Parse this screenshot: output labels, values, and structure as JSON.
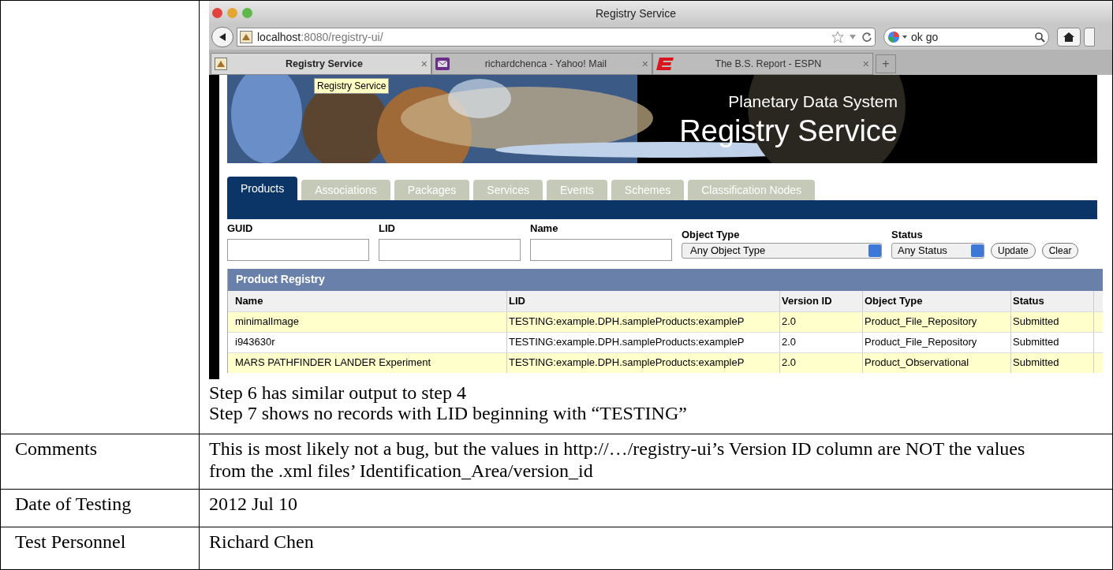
{
  "browser": {
    "title": "Registry Service",
    "url_host": "localhost",
    "url_rest": ":8080/registry-ui/",
    "search_value": "ok go",
    "tabs": [
      {
        "label": "Registry Service",
        "selected": true,
        "kind": "app"
      },
      {
        "label": "richardchenca - Yahoo! Mail",
        "selected": false,
        "kind": "mail"
      },
      {
        "label": "The B.S. Report - ESPN",
        "selected": false,
        "kind": "espn"
      }
    ],
    "new_tab": "+",
    "tab_close": "×"
  },
  "page": {
    "tooltip": "Registry Service",
    "banner_subtitle": "Planetary Data System",
    "banner_title": "Registry Service",
    "tabs": [
      {
        "label": "Products",
        "selected": true
      },
      {
        "label": "Associations",
        "selected": false
      },
      {
        "label": "Packages",
        "selected": false
      },
      {
        "label": "Services",
        "selected": false
      },
      {
        "label": "Events",
        "selected": false
      },
      {
        "label": "Schemes",
        "selected": false
      },
      {
        "label": "Classification Nodes",
        "selected": false
      }
    ],
    "filters": {
      "guid_label": "GUID",
      "lid_label": "LID",
      "name_label": "Name",
      "object_type_label": "Object Type",
      "object_type_value": "Any Object Type",
      "status_label": "Status",
      "status_value": "Any Status"
    },
    "buttons": [
      "Update",
      "Clear"
    ],
    "table": {
      "title": "Product Registry",
      "columns": [
        "Name",
        "LID",
        "Version ID",
        "Object Type",
        "Status"
      ],
      "rows": [
        {
          "highlighted": true,
          "cells": [
            "minimalImage",
            "TESTING:example.DPH.sampleProducts:exampleP",
            "2.0",
            "Product_File_Repository",
            "Submitted"
          ]
        },
        {
          "highlighted": false,
          "cells": [
            "i943630r",
            "TESTING:example.DPH.sampleProducts:exampleP",
            "2.0",
            "Product_File_Repository",
            "Submitted"
          ]
        },
        {
          "highlighted": true,
          "cells": [
            "MARS PATHFINDER LANDER Experiment",
            "TESTING:example.DPH.sampleProducts:exampleP",
            "2.0",
            "Product_Observational",
            "Submitted"
          ]
        }
      ]
    }
  },
  "notes": [
    "Step 6 has similar output to step 4",
    "Step 7 shows no records with LID beginning with “TESTING”"
  ],
  "rows": [
    {
      "label": "Comments",
      "value": "This is most likely not a bug, but the values in http://…/registry-ui’s Version ID column are NOT the values from the .xml files’ Identification_Area/version_id"
    },
    {
      "label": "Date of Testing",
      "value": "2012 Jul 10"
    },
    {
      "label": "Test Personnel",
      "value": "Richard Chen"
    }
  ]
}
